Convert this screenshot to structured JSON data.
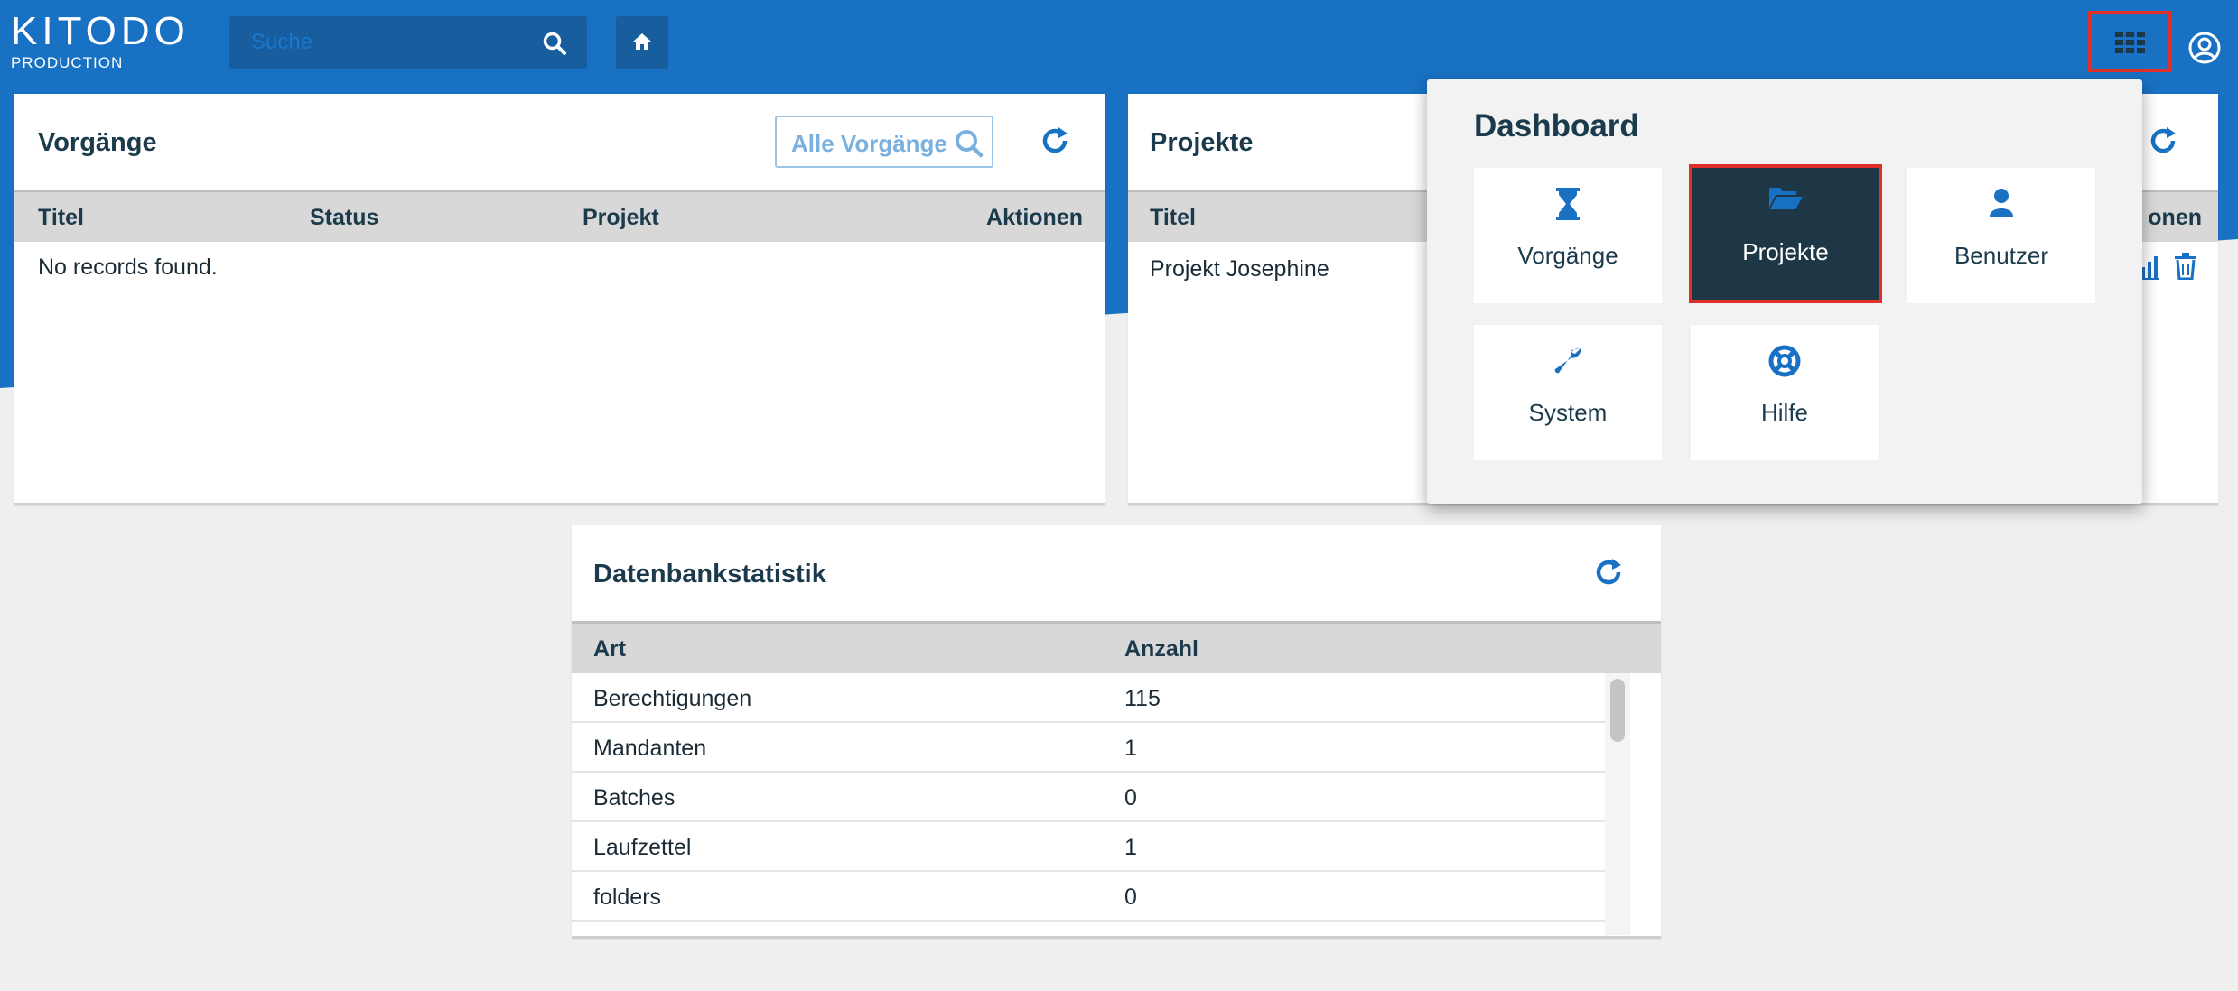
{
  "header": {
    "logo_main": "KITODO",
    "logo_sub": "PRODUCTION",
    "search_placeholder": "Suche"
  },
  "processes_panel": {
    "title": "Vorgänge",
    "filter_label": "Alle Vorgänge",
    "columns": [
      "Titel",
      "Status",
      "Projekt",
      "Aktionen"
    ],
    "empty_text": "No records found."
  },
  "projects_panel": {
    "title": "Projekte",
    "columns": [
      "Titel",
      "onen"
    ],
    "rows": [
      {
        "title": "Projekt Josephine"
      }
    ]
  },
  "stats_panel": {
    "title": "Datenbankstatistik",
    "columns": [
      "Art",
      "Anzahl"
    ],
    "rows": [
      {
        "type": "Berechtigungen",
        "count": "115"
      },
      {
        "type": "Mandanten",
        "count": "1"
      },
      {
        "type": "Batches",
        "count": "0"
      },
      {
        "type": "Laufzettel",
        "count": "1"
      },
      {
        "type": "folders",
        "count": "0"
      }
    ]
  },
  "dashboard_menu": {
    "title": "Dashboard",
    "tiles": [
      {
        "label": "Vorgänge",
        "icon": "hourglass-icon"
      },
      {
        "label": "Projekte",
        "icon": "folder-open-icon",
        "selected": true
      },
      {
        "label": "Benutzer",
        "icon": "user-icon"
      },
      {
        "label": "System",
        "icon": "wrench-icon"
      },
      {
        "label": "Hilfe",
        "icon": "lifebuoy-icon"
      }
    ]
  },
  "colors": {
    "brand_blue": "#1871c3",
    "dark_navy": "#1e3746",
    "highlight_red": "#e0302a"
  }
}
